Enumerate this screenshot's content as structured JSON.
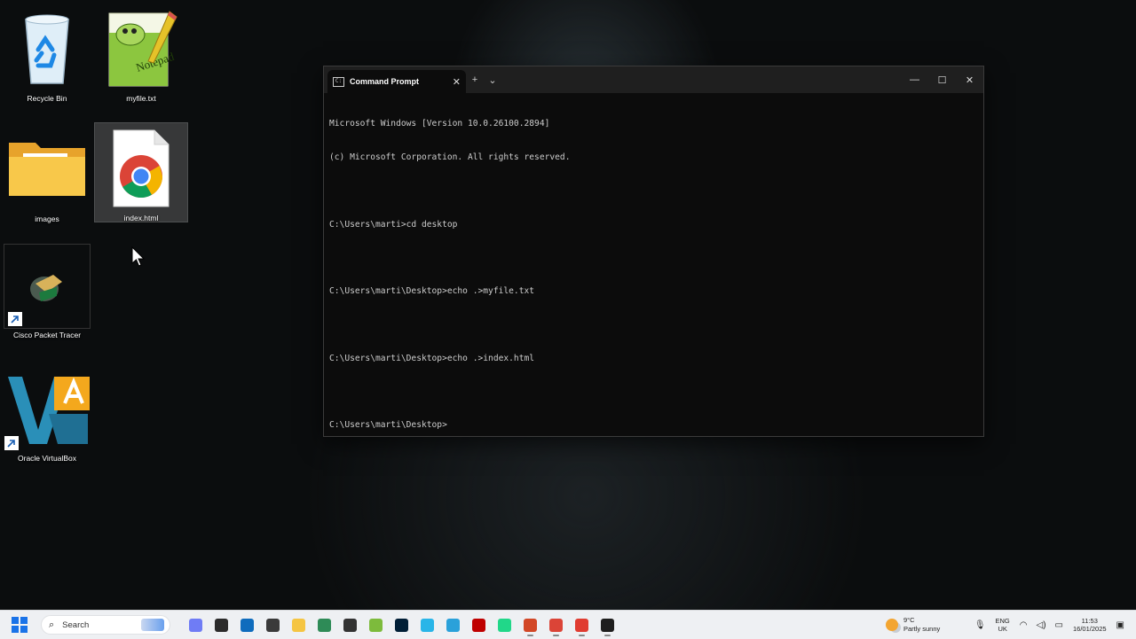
{
  "desktop": {
    "icons": [
      {
        "label": "Recycle Bin"
      },
      {
        "label": "myfile.txt"
      },
      {
        "label": "images"
      },
      {
        "label": "index.html"
      },
      {
        "label": "Cisco Packet Tracer"
      },
      {
        "label": "Oracle VirtualBox"
      }
    ]
  },
  "terminal": {
    "tab_title": "Command Prompt",
    "new_tab": "+",
    "dropdown": "⌄",
    "controls": {
      "minimize": "—",
      "maximize": "☐",
      "close": "✕"
    },
    "lines": [
      "Microsoft Windows [Version 10.0.26100.2894]",
      "(c) Microsoft Corporation. All rights reserved.",
      "",
      "C:\\Users\\marti>cd desktop",
      "",
      "C:\\Users\\marti\\Desktop>echo .>myfile.txt",
      "",
      "C:\\Users\\marti\\Desktop>echo .>index.html",
      "",
      "C:\\Users\\marti\\Desktop>"
    ]
  },
  "taskbar": {
    "search_placeholder": "Search",
    "apps": [
      {
        "icon": "copilot-icon",
        "color": "#6f7cf5"
      },
      {
        "icon": "obs-icon",
        "color": "#2b2b2b"
      },
      {
        "icon": "outlook-icon",
        "color": "#0f6cbd"
      },
      {
        "icon": "terminal-icon",
        "color": "#3a3a3a"
      },
      {
        "icon": "file-explorer-icon",
        "color": "#f5c542"
      },
      {
        "icon": "app-icon",
        "color": "#2e8b57"
      },
      {
        "icon": "github-icon",
        "color": "#333333"
      },
      {
        "icon": "notepadpp-icon",
        "color": "#7dbb3c"
      },
      {
        "icon": "photoshop-icon",
        "color": "#001e36"
      },
      {
        "icon": "snowflake-icon",
        "color": "#29b5e8"
      },
      {
        "icon": "telegram-icon",
        "color": "#2aa1da"
      },
      {
        "icon": "filezilla-icon",
        "color": "#bf0000"
      },
      {
        "icon": "pycharm-icon",
        "color": "#21d789"
      },
      {
        "icon": "powerpoint-icon",
        "color": "#d24726"
      },
      {
        "icon": "chrome-icon",
        "color": "#db4437"
      },
      {
        "icon": "snipping-icon",
        "color": "#e03c31"
      },
      {
        "icon": "command-prompt-icon",
        "color": "#1e1e1e"
      }
    ],
    "weather": {
      "temp": "9°C",
      "desc": "Partly sunny"
    },
    "lang": {
      "line1": "ENG",
      "line2": "UK"
    },
    "clock": {
      "time": "11:53",
      "date": "16/01/2025"
    }
  }
}
